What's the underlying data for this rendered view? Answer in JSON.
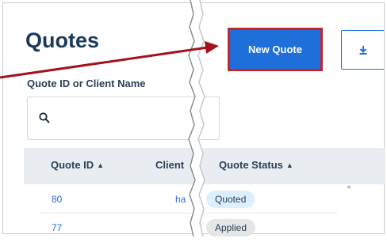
{
  "page": {
    "title": "Quotes"
  },
  "search": {
    "label": "Quote ID or Client Name",
    "value": "",
    "placeholder": "",
    "icon": "search-icon"
  },
  "toolbar": {
    "new_quote_label": "New Quote",
    "download_icon": "download-icon"
  },
  "table": {
    "headers": {
      "quote_id": "Quote ID",
      "client": "Client",
      "status": "Quote Status"
    },
    "sort_glyph": "⬍",
    "rows": [
      {
        "quote_id": "80",
        "client": "ha",
        "status": "Quoted"
      },
      {
        "quote_id": "77",
        "client": "",
        "status": "Applied"
      }
    ]
  },
  "colors": {
    "accent": "#1f6fdb",
    "highlight_border": "#c0262c",
    "annotation_arrow": "#a3111b",
    "title": "#1a3a5c",
    "link": "#2b6fd1",
    "badge_quoted": "#dcefff",
    "badge_applied": "#e6e6e6"
  }
}
